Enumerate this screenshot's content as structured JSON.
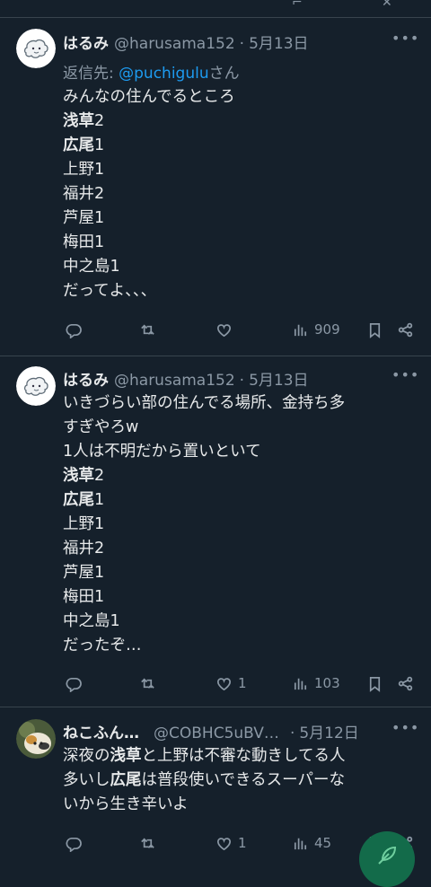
{
  "tweets": [
    {
      "author": "はるみ",
      "handle": "@harusama152",
      "dot": "·",
      "date": "5月13日",
      "reply_prefix": "返信先: ",
      "reply_mention": "@puchigulu",
      "reply_suffix": "さん",
      "lines": [
        [
          {
            "t": "みんなの住んでるところ",
            "b": false
          }
        ],
        [
          {
            "t": "浅草",
            "b": true
          },
          {
            "t": "2",
            "b": false
          }
        ],
        [
          {
            "t": "広尾",
            "b": true
          },
          {
            "t": "1",
            "b": false
          }
        ],
        [
          {
            "t": "上野1",
            "b": false
          }
        ],
        [
          {
            "t": "福井2",
            "b": false
          }
        ],
        [
          {
            "t": "芦屋1",
            "b": false
          }
        ],
        [
          {
            "t": "梅田1",
            "b": false
          }
        ],
        [
          {
            "t": "中之島1",
            "b": false
          }
        ],
        [
          {
            "t": "だってよ、、、",
            "b": false
          }
        ]
      ],
      "likes": "",
      "views": "909",
      "avatar": "white-ghost-avatar"
    },
    {
      "author": "はるみ",
      "handle": "@harusama152",
      "dot": "·",
      "date": "5月13日",
      "lines": [
        [
          {
            "t": "いきづらい部の住んでる場所、金持ち多",
            "b": false
          }
        ],
        [
          {
            "t": "すぎやろw",
            "b": false
          }
        ],
        [
          {
            "t": "1人は不明だから置いといて",
            "b": false
          }
        ],
        [
          {
            "t": "浅草",
            "b": true
          },
          {
            "t": "2",
            "b": false
          }
        ],
        [
          {
            "t": "広尾",
            "b": true
          },
          {
            "t": "1",
            "b": false
          }
        ],
        [
          {
            "t": "上野1",
            "b": false
          }
        ],
        [
          {
            "t": "福井2",
            "b": false
          }
        ],
        [
          {
            "t": "芦屋1",
            "b": false
          }
        ],
        [
          {
            "t": "梅田1",
            "b": false
          }
        ],
        [
          {
            "t": "中之島1",
            "b": false
          }
        ],
        [
          {
            "t": "だったぞ…",
            "b": false
          }
        ]
      ],
      "likes": "1",
      "views": "103",
      "avatar": "white-ghost-avatar"
    },
    {
      "author": "ねこふん…",
      "handle": "@COBHC5uBV…",
      "dot": "·",
      "date": "5月12日",
      "lines": [
        [
          {
            "t": "深夜の",
            "b": false
          },
          {
            "t": "浅草",
            "b": true
          },
          {
            "t": "と上野は不審な動きしてる人",
            "b": false
          }
        ],
        [
          {
            "t": "多いし",
            "b": false
          },
          {
            "t": "広尾",
            "b": true
          },
          {
            "t": "は普段使いできるスーパーな",
            "b": false
          }
        ],
        [
          {
            "t": "いから生き辛いよ",
            "b": false
          }
        ]
      ],
      "likes": "1",
      "views": "45",
      "avatar": "cat-photo-avatar"
    }
  ],
  "icons": {
    "more": "more-horizontal-icon",
    "reply": "reply-icon",
    "retweet": "retweet-icon",
    "like": "heart-icon",
    "views": "views-icon",
    "bookmark": "bookmark-icon",
    "share": "share-icon",
    "compose": "compose-feather-icon"
  },
  "colors": {
    "background": "#15202b",
    "text": "#e7e9ea",
    "muted": "#8b98a5",
    "mention": "#1d9bf0",
    "divider": "#38444d",
    "fab": "#136b4a"
  }
}
